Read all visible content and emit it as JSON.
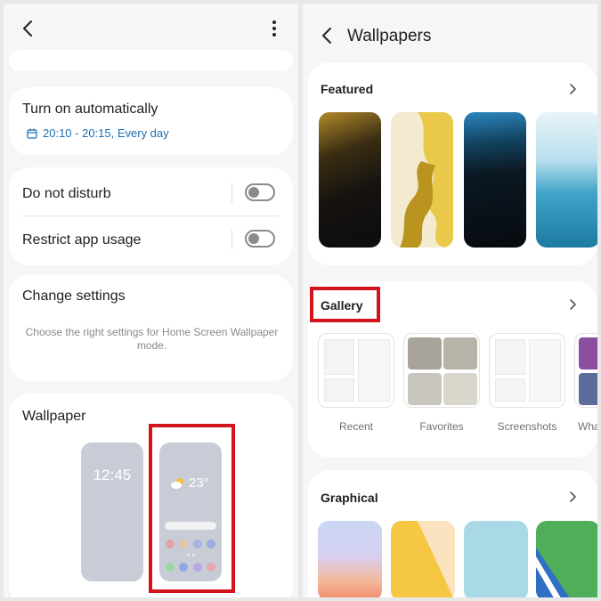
{
  "left": {
    "turn_on": {
      "title": "Turn on automatically",
      "schedule": "20:10 - 20:15, Every day"
    },
    "dnd": {
      "label": "Do not disturb"
    },
    "restrict": {
      "label": "Restrict app usage"
    },
    "change": {
      "title": "Change settings",
      "description": "Choose the right settings for Home Screen Wallpaper mode."
    },
    "wallpaper": {
      "title": "Wallpaper",
      "lock_time": "12:45",
      "home_temp": "23°"
    }
  },
  "right": {
    "title": "Wallpapers",
    "featured": {
      "title": "Featured"
    },
    "gallery": {
      "title": "Gallery",
      "items": [
        {
          "label": "Recent"
        },
        {
          "label": "Favorites"
        },
        {
          "label": "Screenshots"
        },
        {
          "label": "What"
        }
      ]
    },
    "graphical": {
      "title": "Graphical"
    }
  },
  "colors": {
    "highlight": "#d4141c",
    "link_blue": "#1b6fb5",
    "card": "#ffffff",
    "panel": "#f6f6f6"
  }
}
